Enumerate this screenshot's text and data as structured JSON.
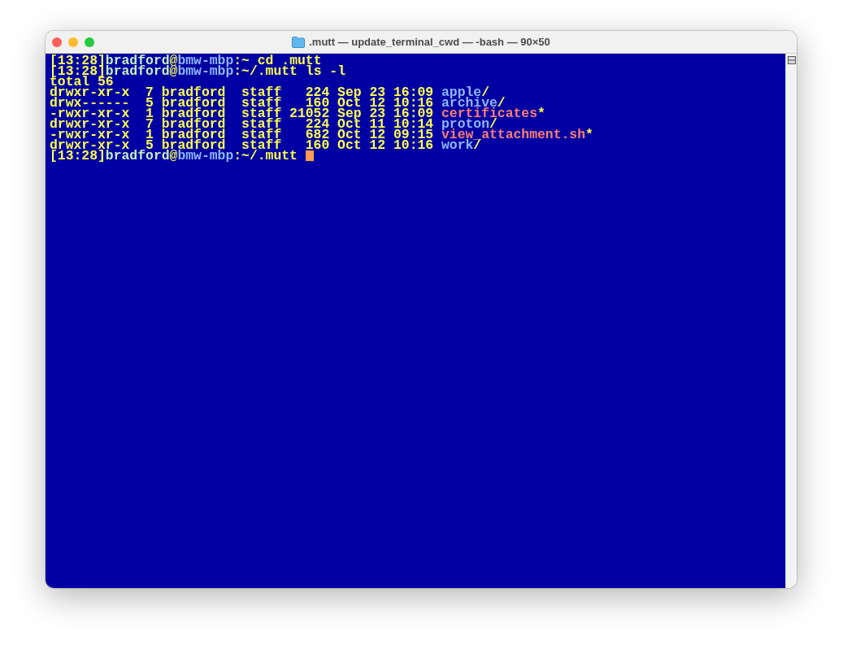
{
  "window": {
    "title": ".mutt — update_terminal_cwd — -bash — 90×50"
  },
  "terminal": {
    "lines": [
      {
        "kind": "prompt",
        "segments": [
          {
            "kind": "time",
            "text": "[13:28]"
          },
          {
            "kind": "user",
            "text": "bradford"
          },
          {
            "kind": "sep",
            "text": "@"
          },
          {
            "kind": "host",
            "text": "bmw-mbp"
          },
          {
            "kind": "sep",
            "text": ":~"
          }
        ],
        "command": "cd .mutt"
      },
      {
        "kind": "prompt",
        "segments": [
          {
            "kind": "time",
            "text": "[13:28]"
          },
          {
            "kind": "user",
            "text": "bradford"
          },
          {
            "kind": "sep",
            "text": "@"
          },
          {
            "kind": "host",
            "text": "bmw-mbp"
          },
          {
            "kind": "sep",
            "text": ":~/.mutt"
          }
        ],
        "command": "ls -l"
      },
      {
        "kind": "output",
        "text": "total 56"
      },
      {
        "kind": "entry",
        "perms": "drwxr-xr-x",
        "links": "7",
        "owner": "bradford",
        "group": "staff",
        "size": "224",
        "month": "Sep",
        "day": "23",
        "time": "16:09",
        "name": "apple",
        "suffix": "/",
        "executable": false
      },
      {
        "kind": "entry",
        "perms": "drwx------",
        "links": "5",
        "owner": "bradford",
        "group": "staff",
        "size": "160",
        "month": "Oct",
        "day": "12",
        "time": "10:16",
        "name": "archive",
        "suffix": "/",
        "executable": false
      },
      {
        "kind": "entry",
        "perms": "-rwxr-xr-x",
        "links": "1",
        "owner": "bradford",
        "group": "staff",
        "size": "21052",
        "month": "Sep",
        "day": "23",
        "time": "16:09",
        "name": "certificates",
        "suffix": "*",
        "executable": true
      },
      {
        "kind": "entry",
        "perms": "drwxr-xr-x",
        "links": "7",
        "owner": "bradford",
        "group": "staff",
        "size": "224",
        "month": "Oct",
        "day": "11",
        "time": "10:14",
        "name": "proton",
        "suffix": "/",
        "executable": false
      },
      {
        "kind": "entry",
        "perms": "-rwxr-xr-x",
        "links": "1",
        "owner": "bradford",
        "group": "staff",
        "size": "682",
        "month": "Oct",
        "day": "12",
        "time": "09:15",
        "name": "view_attachment.sh",
        "suffix": "*",
        "executable": true
      },
      {
        "kind": "entry",
        "perms": "drwxr-xr-x",
        "links": "5",
        "owner": "bradford",
        "group": "staff",
        "size": "160",
        "month": "Oct",
        "day": "12",
        "time": "10:16",
        "name": "work",
        "suffix": "/",
        "executable": false
      },
      {
        "kind": "prompt",
        "segments": [
          {
            "kind": "time",
            "text": "[13:28]"
          },
          {
            "kind": "user",
            "text": "bradford"
          },
          {
            "kind": "sep",
            "text": "@"
          },
          {
            "kind": "host",
            "text": "bmw-mbp"
          },
          {
            "kind": "sep",
            "text": ":~/.mutt"
          }
        ],
        "cursor": true
      }
    ]
  }
}
